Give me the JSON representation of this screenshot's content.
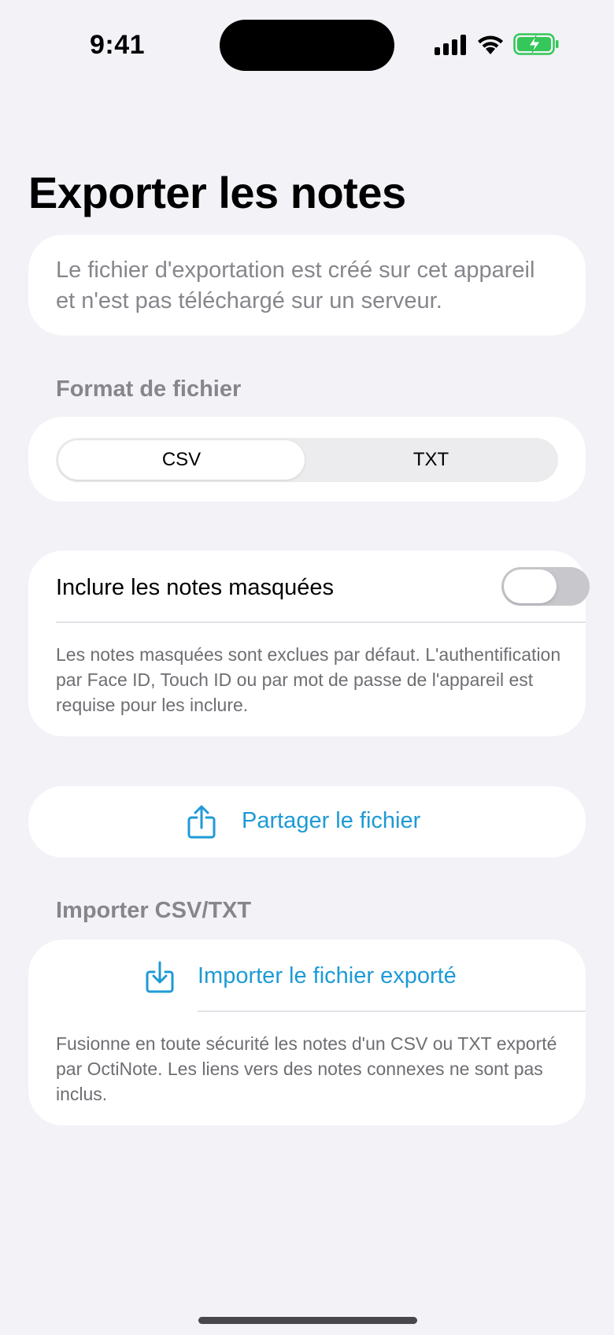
{
  "status_bar": {
    "time": "9:41"
  },
  "page": {
    "title": "Exporter les notes",
    "info_text": "Le fichier d'exportation est créé sur cet appareil et n'est pas téléchargé sur un serveur."
  },
  "format_section": {
    "header": "Format de fichier",
    "options": [
      "CSV",
      "TXT"
    ],
    "selected": "CSV"
  },
  "hidden_notes": {
    "label": "Inclure les notes masquées",
    "enabled": false,
    "footnote": "Les notes masquées sont exclues par défaut. L'authentification par Face ID, Touch ID ou par mot de passe de l'appareil est requise pour les inclure."
  },
  "share": {
    "label": "Partager le fichier",
    "icon": "share-icon"
  },
  "import_section": {
    "header": "Importer CSV/TXT",
    "button_label": "Importer le fichier exporté",
    "icon": "import-icon",
    "footnote": "Fusionne en toute sécurité les notes d'un CSV ou TXT exporté par OctiNote. Les liens vers des notes connexes ne sont pas inclus."
  },
  "colors": {
    "background": "#f2f2f7",
    "accent": "#1e9ad6",
    "secondary_text": "#86868c",
    "battery_green": "#34c759"
  }
}
